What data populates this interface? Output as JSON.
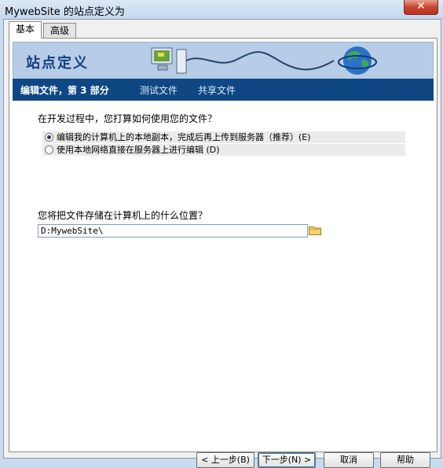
{
  "window": {
    "title": "MywebSite 的站点定义为",
    "close_glyph": "✕"
  },
  "tabs": [
    {
      "label": "基本",
      "active": true
    },
    {
      "label": "高级",
      "active": false
    }
  ],
  "banner": {
    "title": "站点定义"
  },
  "steps": [
    {
      "label": "编辑文件，第 3 部分",
      "current": true
    },
    {
      "label": "测试文件",
      "current": false
    },
    {
      "label": "共享文件",
      "current": false
    }
  ],
  "question1": "在开发过程中，您打算如何使用您的文件？",
  "options": [
    {
      "label": "编辑我的计算机上的本地副本，完成后再上传到服务器（推荐）(E)",
      "selected": true
    },
    {
      "label": "使用本地网络直接在服务器上进行编辑 (D)",
      "selected": false
    }
  ],
  "question2": "您将把文件存储在计算机上的什么位置？",
  "path_value": "D:MywebSite\\",
  "buttons": {
    "back": "< 上一步(B)",
    "next": "下一步(N) >",
    "cancel": "取消",
    "help": "帮助"
  },
  "colors": {
    "banner_bg": "#b7cce6",
    "steps_bg": "#0f4784",
    "title_text": "#14407f"
  }
}
